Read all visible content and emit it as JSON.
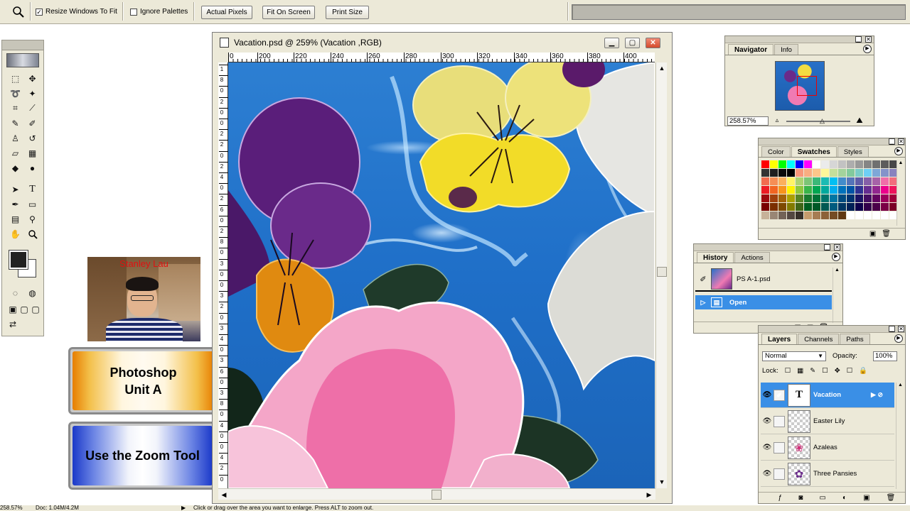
{
  "options_bar": {
    "resize_windows": {
      "label": "Resize Windows To Fit",
      "checked": true
    },
    "ignore_palettes": {
      "label": "Ignore Palettes",
      "checked": false
    },
    "buttons": [
      "Actual Pixels",
      "Fit On Screen",
      "Print Size"
    ]
  },
  "presenter": {
    "name": "Stanley Lau"
  },
  "slides": {
    "title_line1": "Photoshop",
    "title_line2": "Unit A",
    "topic": "Use the Zoom Tool"
  },
  "document": {
    "title": "Vacation.psd @ 259% (Vacation ,RGB)",
    "ruler_top": [
      "0",
      "200",
      "220",
      "240",
      "260",
      "280",
      "300",
      "320",
      "340",
      "360",
      "380",
      "400"
    ],
    "ruler_left": [
      "1",
      "8",
      "0",
      "2",
      "0",
      "0",
      "2",
      "2",
      "0",
      "2",
      "4",
      "0",
      "2",
      "6",
      "0",
      "2",
      "8",
      "0",
      "3",
      "0",
      "0",
      "3",
      "2",
      "0",
      "3",
      "4",
      "0",
      "3",
      "6",
      "0",
      "3",
      "8",
      "0",
      "4",
      "0",
      "0",
      "4",
      "2",
      "0"
    ]
  },
  "navigator": {
    "tabs": [
      "Navigator",
      "Info"
    ],
    "active_tab": "Navigator",
    "zoom": "258.57%"
  },
  "swatches": {
    "tabs": [
      "Color",
      "Swatches",
      "Styles"
    ],
    "active_tab": "Swatches",
    "colors": [
      "#ff0000",
      "#ffff00",
      "#00ff00",
      "#00ffff",
      "#0000ff",
      "#ff00ff",
      "#ffffff",
      "#ebebeb",
      "#d6d6d6",
      "#c2c2c2",
      "#adadad",
      "#999999",
      "#858585",
      "#707070",
      "#5c5c5c",
      "#474747",
      "#333333",
      "#1f1f1f",
      "#0a0a0a",
      "#000000",
      "#f7977a",
      "#f9ad81",
      "#fdc68a",
      "#fff79a",
      "#c4df9b",
      "#a3d39c",
      "#82ca9d",
      "#7bcdc8",
      "#6ecff6",
      "#7ea7d8",
      "#8493ca",
      "#8882be",
      "#f26c4f",
      "#f68e55",
      "#fbaf5c",
      "#fff467",
      "#acd372",
      "#7cc576",
      "#3bb878",
      "#1abbb4",
      "#00bff3",
      "#438ccb",
      "#5574b9",
      "#605ca8",
      "#855fa8",
      "#a763a8",
      "#f06ea9",
      "#f26d7d",
      "#ed1c24",
      "#f26522",
      "#f7941d",
      "#fff200",
      "#8dc63f",
      "#39b54a",
      "#00a651",
      "#00a99d",
      "#00aeef",
      "#0072bc",
      "#0054a6",
      "#2e3192",
      "#662d91",
      "#92278f",
      "#ec008c",
      "#ed145b",
      "#9e0b0f",
      "#a0410d",
      "#a36209",
      "#aba000",
      "#598527",
      "#1a7b30",
      "#007236",
      "#00746b",
      "#0076a3",
      "#004b80",
      "#003471",
      "#1b1464",
      "#440e62",
      "#630460",
      "#9e005d",
      "#9e0039",
      "#790000",
      "#7b2e00",
      "#7d4900",
      "#827b00",
      "#406618",
      "#005e20",
      "#005826",
      "#005952",
      "#005b7f",
      "#003663",
      "#002157",
      "#0d004c",
      "#32004b",
      "#4b0049",
      "#7b0046",
      "#7a0026",
      "#c7b299",
      "#998675",
      "#736357",
      "#534741",
      "#37302a",
      "#c69c6d",
      "#a67c52",
      "#8c6239",
      "#754c24",
      "#603913",
      "#ffffff",
      "#ffffff",
      "#ffffff",
      "#ffffff",
      "#ffffff",
      "#ffffff"
    ]
  },
  "history": {
    "tabs": [
      "History",
      "Actions"
    ],
    "active_tab": "History",
    "snapshot": "PS A-1.psd",
    "states": [
      "Open"
    ]
  },
  "layers": {
    "tabs": [
      "Layers",
      "Channels",
      "Paths"
    ],
    "active_tab": "Layers",
    "blend_mode": "Normal",
    "opacity_label": "Opacity:",
    "opacity": "100%",
    "lock_label": "Lock:",
    "items": [
      {
        "name": "Vacation",
        "thumb": "T",
        "selected": true
      },
      {
        "name": "Easter Lily",
        "thumb": "",
        "selected": false
      },
      {
        "name": "Azaleas",
        "thumb": "❀",
        "selected": false
      },
      {
        "name": "Three Pansies",
        "thumb": "✿",
        "selected": false
      }
    ]
  },
  "status": {
    "zoom": "258.57%",
    "doc": "Doc: 1.04M/4.2M",
    "hint": "Click or drag over the area you want to enlarge. Press ALT to zoom out."
  }
}
